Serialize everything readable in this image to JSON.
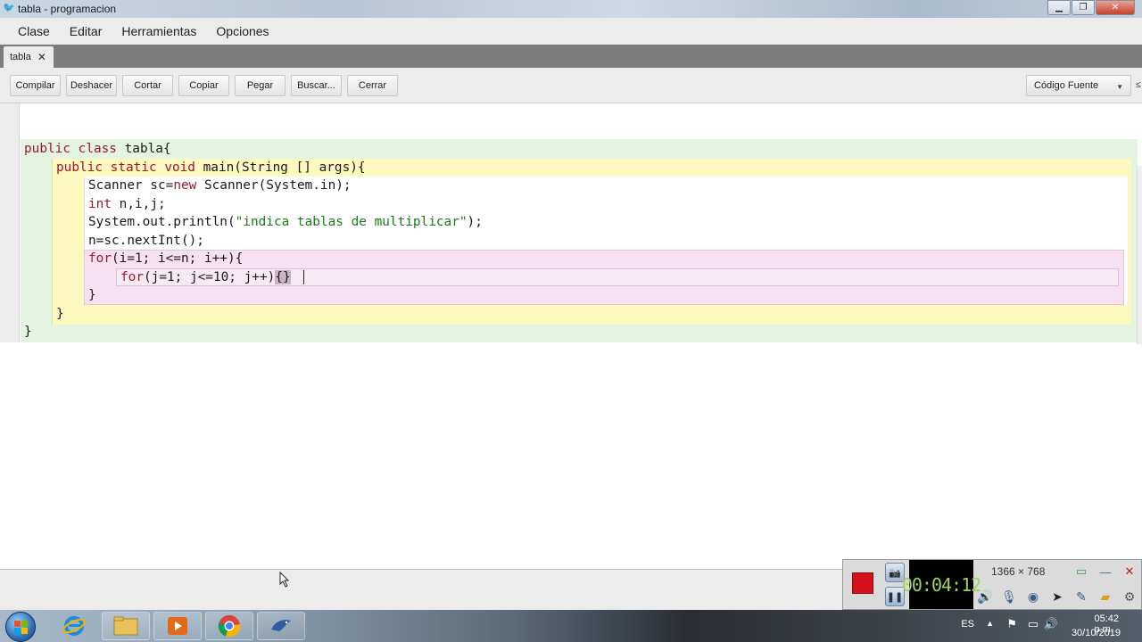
{
  "window": {
    "title": "tabla - programacion",
    "buttons": {
      "minimize": "▁",
      "maximize": "❐",
      "close": "✕"
    }
  },
  "menu": [
    "Clase",
    "Editar",
    "Herramientas",
    "Opciones"
  ],
  "tabs": [
    {
      "label": "tabla",
      "close": "✕"
    }
  ],
  "toolbar": {
    "buttons": [
      "Compilar",
      "Deshacer",
      "Cortar",
      "Copiar",
      "Pegar",
      "Buscar...",
      "Cerrar"
    ],
    "view_select": "Código Fuente"
  },
  "editor": {
    "lines": [
      "public class tabla{",
      "public static void main(String [] args){",
      "Scanner sc=new Scanner(System.in);",
      "int n,i,j;",
      "System.out.println(\"indica tablas de multiplicar\");",
      "n=sc.nextInt();",
      "for(i=1; i<=n; i++){",
      "for(j=1; j<=10; j++){}",
      "}",
      "}",
      "}"
    ]
  },
  "recorder": {
    "timer": "00:04:12",
    "resolution": "1366 × 768"
  },
  "taskbar": {
    "language": "ES",
    "time": "05:42 p.m.",
    "date": "30/10/2019"
  },
  "colors": {
    "class_scope": "#e3f5e1",
    "method_scope": "#fcf8c0",
    "loop_scope": "#f5e1f2",
    "keyword": "#a1172a",
    "string": "#1c7a1c"
  }
}
